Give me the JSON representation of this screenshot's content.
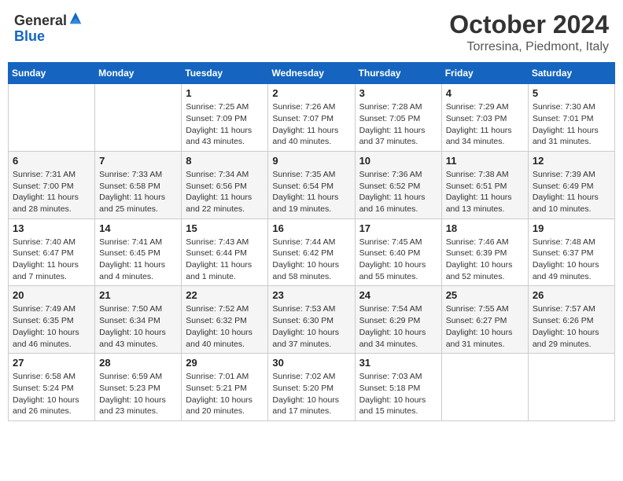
{
  "header": {
    "logo_line1": "General",
    "logo_line2": "Blue",
    "month": "October 2024",
    "location": "Torresina, Piedmont, Italy"
  },
  "days_of_week": [
    "Sunday",
    "Monday",
    "Tuesday",
    "Wednesday",
    "Thursday",
    "Friday",
    "Saturday"
  ],
  "weeks": [
    [
      {
        "day": "",
        "info": ""
      },
      {
        "day": "",
        "info": ""
      },
      {
        "day": "1",
        "info": "Sunrise: 7:25 AM\nSunset: 7:09 PM\nDaylight: 11 hours and 43 minutes."
      },
      {
        "day": "2",
        "info": "Sunrise: 7:26 AM\nSunset: 7:07 PM\nDaylight: 11 hours and 40 minutes."
      },
      {
        "day": "3",
        "info": "Sunrise: 7:28 AM\nSunset: 7:05 PM\nDaylight: 11 hours and 37 minutes."
      },
      {
        "day": "4",
        "info": "Sunrise: 7:29 AM\nSunset: 7:03 PM\nDaylight: 11 hours and 34 minutes."
      },
      {
        "day": "5",
        "info": "Sunrise: 7:30 AM\nSunset: 7:01 PM\nDaylight: 11 hours and 31 minutes."
      }
    ],
    [
      {
        "day": "6",
        "info": "Sunrise: 7:31 AM\nSunset: 7:00 PM\nDaylight: 11 hours and 28 minutes."
      },
      {
        "day": "7",
        "info": "Sunrise: 7:33 AM\nSunset: 6:58 PM\nDaylight: 11 hours and 25 minutes."
      },
      {
        "day": "8",
        "info": "Sunrise: 7:34 AM\nSunset: 6:56 PM\nDaylight: 11 hours and 22 minutes."
      },
      {
        "day": "9",
        "info": "Sunrise: 7:35 AM\nSunset: 6:54 PM\nDaylight: 11 hours and 19 minutes."
      },
      {
        "day": "10",
        "info": "Sunrise: 7:36 AM\nSunset: 6:52 PM\nDaylight: 11 hours and 16 minutes."
      },
      {
        "day": "11",
        "info": "Sunrise: 7:38 AM\nSunset: 6:51 PM\nDaylight: 11 hours and 13 minutes."
      },
      {
        "day": "12",
        "info": "Sunrise: 7:39 AM\nSunset: 6:49 PM\nDaylight: 11 hours and 10 minutes."
      }
    ],
    [
      {
        "day": "13",
        "info": "Sunrise: 7:40 AM\nSunset: 6:47 PM\nDaylight: 11 hours and 7 minutes."
      },
      {
        "day": "14",
        "info": "Sunrise: 7:41 AM\nSunset: 6:45 PM\nDaylight: 11 hours and 4 minutes."
      },
      {
        "day": "15",
        "info": "Sunrise: 7:43 AM\nSunset: 6:44 PM\nDaylight: 11 hours and 1 minute."
      },
      {
        "day": "16",
        "info": "Sunrise: 7:44 AM\nSunset: 6:42 PM\nDaylight: 10 hours and 58 minutes."
      },
      {
        "day": "17",
        "info": "Sunrise: 7:45 AM\nSunset: 6:40 PM\nDaylight: 10 hours and 55 minutes."
      },
      {
        "day": "18",
        "info": "Sunrise: 7:46 AM\nSunset: 6:39 PM\nDaylight: 10 hours and 52 minutes."
      },
      {
        "day": "19",
        "info": "Sunrise: 7:48 AM\nSunset: 6:37 PM\nDaylight: 10 hours and 49 minutes."
      }
    ],
    [
      {
        "day": "20",
        "info": "Sunrise: 7:49 AM\nSunset: 6:35 PM\nDaylight: 10 hours and 46 minutes."
      },
      {
        "day": "21",
        "info": "Sunrise: 7:50 AM\nSunset: 6:34 PM\nDaylight: 10 hours and 43 minutes."
      },
      {
        "day": "22",
        "info": "Sunrise: 7:52 AM\nSunset: 6:32 PM\nDaylight: 10 hours and 40 minutes."
      },
      {
        "day": "23",
        "info": "Sunrise: 7:53 AM\nSunset: 6:30 PM\nDaylight: 10 hours and 37 minutes."
      },
      {
        "day": "24",
        "info": "Sunrise: 7:54 AM\nSunset: 6:29 PM\nDaylight: 10 hours and 34 minutes."
      },
      {
        "day": "25",
        "info": "Sunrise: 7:55 AM\nSunset: 6:27 PM\nDaylight: 10 hours and 31 minutes."
      },
      {
        "day": "26",
        "info": "Sunrise: 7:57 AM\nSunset: 6:26 PM\nDaylight: 10 hours and 29 minutes."
      }
    ],
    [
      {
        "day": "27",
        "info": "Sunrise: 6:58 AM\nSunset: 5:24 PM\nDaylight: 10 hours and 26 minutes."
      },
      {
        "day": "28",
        "info": "Sunrise: 6:59 AM\nSunset: 5:23 PM\nDaylight: 10 hours and 23 minutes."
      },
      {
        "day": "29",
        "info": "Sunrise: 7:01 AM\nSunset: 5:21 PM\nDaylight: 10 hours and 20 minutes."
      },
      {
        "day": "30",
        "info": "Sunrise: 7:02 AM\nSunset: 5:20 PM\nDaylight: 10 hours and 17 minutes."
      },
      {
        "day": "31",
        "info": "Sunrise: 7:03 AM\nSunset: 5:18 PM\nDaylight: 10 hours and 15 minutes."
      },
      {
        "day": "",
        "info": ""
      },
      {
        "day": "",
        "info": ""
      }
    ]
  ]
}
